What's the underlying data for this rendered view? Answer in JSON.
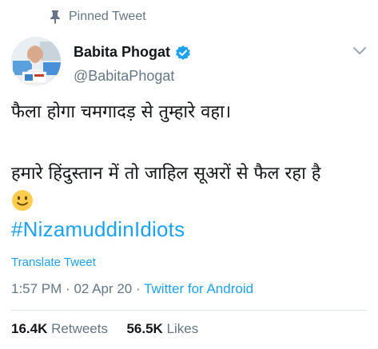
{
  "pinned": {
    "label": "Pinned Tweet",
    "icon": "pin-icon"
  },
  "author": {
    "display_name": "Babita Phogat",
    "handle": "@BabitaPhogat",
    "verified_icon": "verified-badge-icon",
    "verified_color": "#1da1f2"
  },
  "tweet": {
    "line1": "फैला होगा चमगादड़ से तुम्हारे वहा।",
    "line2": "हमारे हिंदुस्तान में तो जाहिल सूअरों से फैल रहा है",
    "emoji": "slightly-smiling-face-emoji",
    "hashtag": "#NizamuddinIdiots"
  },
  "translate_label": "Translate Tweet",
  "meta": {
    "time": "1:57 PM",
    "separator1": "·",
    "date": "02 Apr 20",
    "separator2": "·",
    "source": "Twitter for Android"
  },
  "stats": {
    "retweets_count": "16.4K",
    "retweets_label": "Retweets",
    "likes_count": "56.5K",
    "likes_label": "Likes"
  },
  "colors": {
    "link": "#1da1f2",
    "secondary_text": "#657786",
    "primary_text": "#14171a"
  }
}
